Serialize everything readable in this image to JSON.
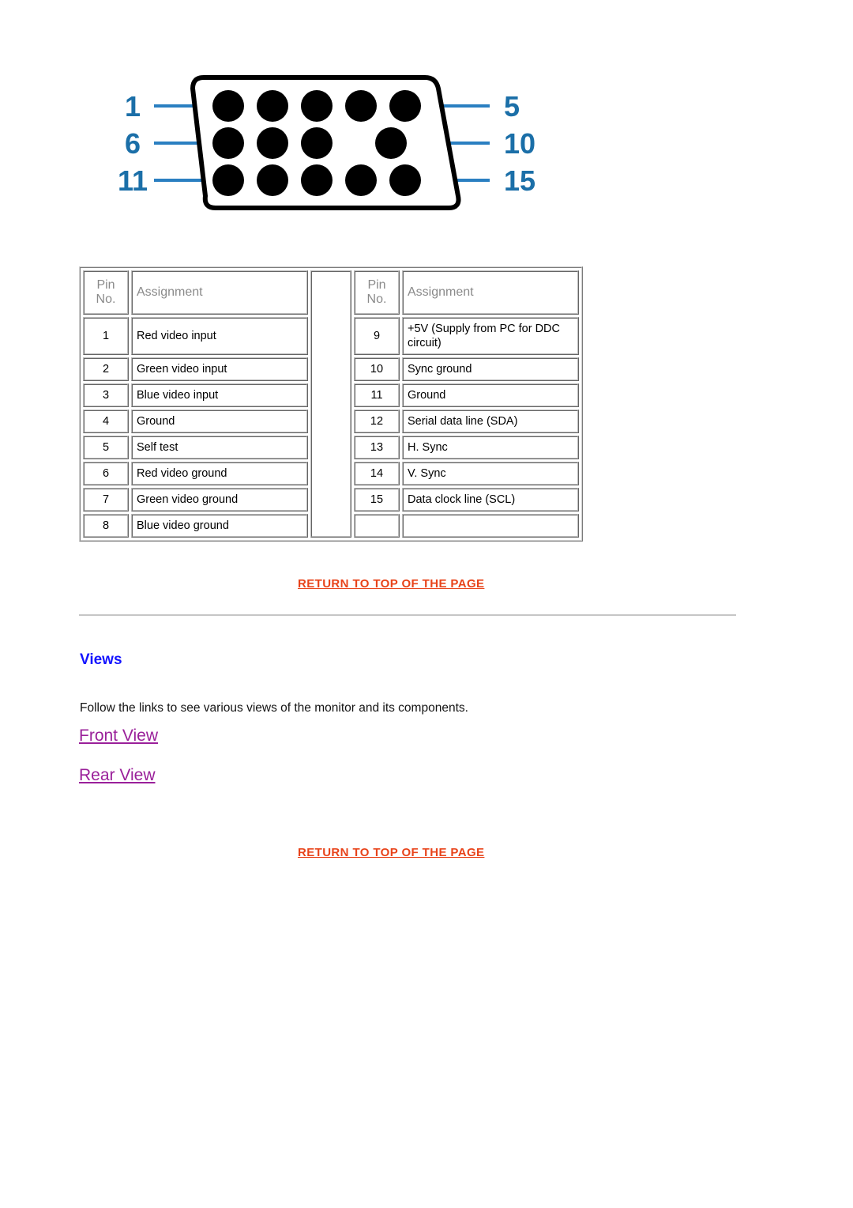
{
  "diagram": {
    "name": "15-pin-d-sub-connector",
    "left_labels": [
      "1",
      "6",
      "11"
    ],
    "right_labels": [
      "5",
      "10",
      "15"
    ],
    "label_color": "#1b6fa8",
    "leader_color": "#2a7fc1",
    "outline_color": "#000000",
    "pin_color": "#000000"
  },
  "pin_table": {
    "headers": {
      "pin_no": "Pin\nNo.",
      "pin_no_line1": "Pin",
      "pin_no_line2": "No.",
      "assignment": "Assignment"
    },
    "left_rows": [
      {
        "pin": "1",
        "assignment": "Red video input"
      },
      {
        "pin": "2",
        "assignment": "Green video input"
      },
      {
        "pin": "3",
        "assignment": "Blue video input"
      },
      {
        "pin": "4",
        "assignment": "Ground"
      },
      {
        "pin": "5",
        "assignment": "Self test"
      },
      {
        "pin": "6",
        "assignment": "Red video ground"
      },
      {
        "pin": "7",
        "assignment": "Green video ground"
      },
      {
        "pin": "8",
        "assignment": "Blue video ground"
      }
    ],
    "right_rows": [
      {
        "pin": "9",
        "assignment": "+5V (Supply from PC for DDC circuit)"
      },
      {
        "pin": "10",
        "assignment": "Sync ground"
      },
      {
        "pin": "11",
        "assignment": "Ground"
      },
      {
        "pin": "12",
        "assignment": "Serial data line (SDA)"
      },
      {
        "pin": "13",
        "assignment": "H. Sync"
      },
      {
        "pin": "14",
        "assignment": "V. Sync"
      },
      {
        "pin": "15",
        "assignment": "Data clock line (SCL)"
      },
      {
        "pin": "",
        "assignment": ""
      }
    ]
  },
  "links": {
    "return_to_top_label": "RETURN TO TOP OF THE PAGE",
    "return_to_top_color": "#e8431a",
    "front_view_label": "Front View",
    "rear_view_label": "Rear View",
    "view_link_color": "#9a209a"
  },
  "views_section": {
    "heading": "Views",
    "heading_color": "#1414ff",
    "intro": "Follow the links to see various views of the monitor and its components."
  }
}
